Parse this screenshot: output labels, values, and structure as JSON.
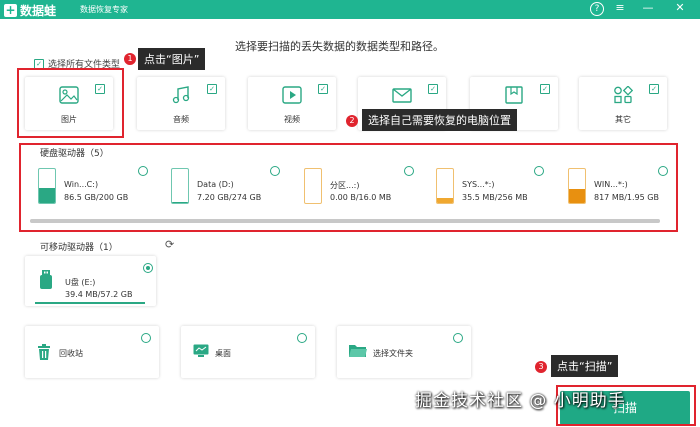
{
  "app": {
    "logo_icon": "plus-icon",
    "logo_text": "数据蛙",
    "subtitle": "数据恢复专家",
    "controls": {
      "help": "?",
      "menu": "≡",
      "minimize": "—",
      "close": "✕"
    }
  },
  "heading": "选择要扫描的丢失数据的数据类型和路径。",
  "select_all": {
    "label": "选择所有文件类型",
    "checked": true
  },
  "file_types": [
    {
      "label": "图片",
      "icon": "image-icon",
      "checked": true
    },
    {
      "label": "音频",
      "icon": "music-icon",
      "checked": true
    },
    {
      "label": "视频",
      "icon": "video-icon",
      "checked": true
    },
    {
      "label": "",
      "icon": "email-icon",
      "checked": true
    },
    {
      "label": "",
      "icon": "document-icon",
      "checked": true
    },
    {
      "label": "其它",
      "icon": "other-icon",
      "checked": true
    }
  ],
  "hard_drives": {
    "title": "硬盘驱动器（5）",
    "drives": [
      {
        "name": "Win...C:)",
        "size": "86.5 GB/200 GB",
        "fill_ratio": 0.43,
        "color": "#2aa884"
      },
      {
        "name": "Data (D:)",
        "size": "7.20 GB/274 GB",
        "fill_ratio": 0.03,
        "color": "#2aa884"
      },
      {
        "name": "分区...:)",
        "size": "0.00  B/16.0 MB",
        "fill_ratio": 0.0,
        "color": "#f0a830"
      },
      {
        "name": "SYS...*:)",
        "size": "35.5 MB/256 MB",
        "fill_ratio": 0.14,
        "color": "#f0a830"
      },
      {
        "name": "WIN...*:)",
        "size": "817 MB/1.95 GB",
        "fill_ratio": 0.42,
        "color": "#e89010"
      }
    ]
  },
  "removable": {
    "title": "可移动驱动器（1）",
    "refresh_icon": "refresh-icon",
    "drive": {
      "name": "U盘 (E:)",
      "size": "39.4 MB/57.2 GB",
      "selected": true,
      "icon": "usb-icon"
    }
  },
  "quick": [
    {
      "label": "回收站",
      "icon": "trash-icon"
    },
    {
      "label": "桌面",
      "icon": "desktop-icon"
    },
    {
      "label": "选择文件夹",
      "icon": "folder-icon"
    }
  ],
  "annotations": {
    "tip1": "点击“图片”",
    "tip2": "选择自己需要恢复的电脑位置",
    "tip3": "点击“扫描”",
    "badge1": "1",
    "badge2": "2",
    "badge3": "3"
  },
  "scan_button": "扫描",
  "watermark": "掘金技术社区 @ 小明助手",
  "colors": {
    "accent": "#1fb591",
    "annotation_red": "#e0242e",
    "tip_bg": "#2b2b2b"
  }
}
